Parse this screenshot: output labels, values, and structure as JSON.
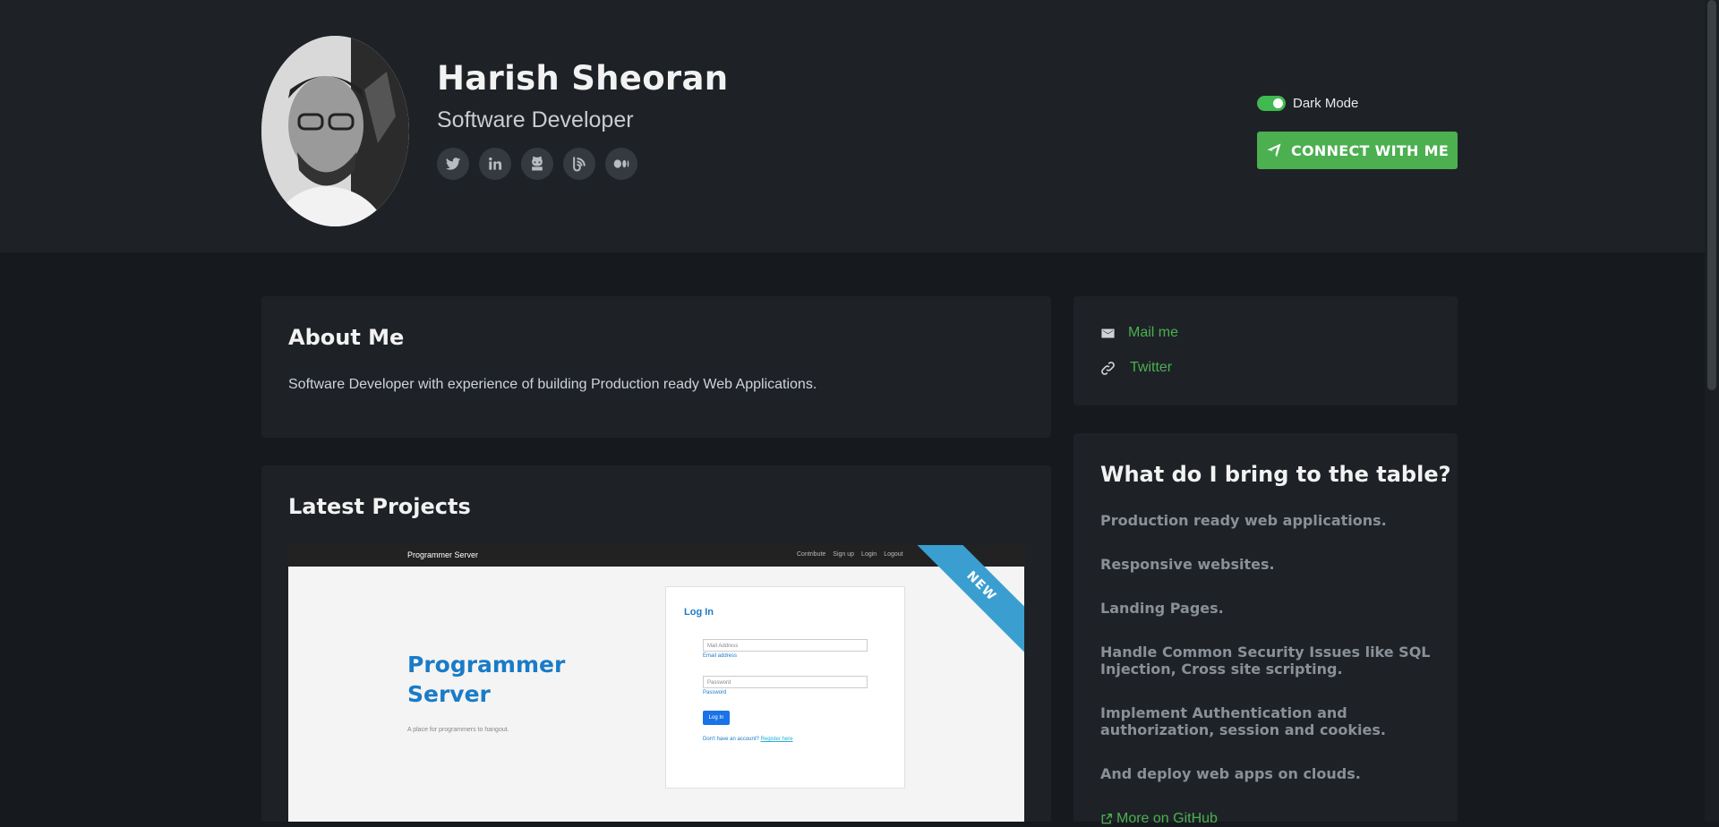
{
  "profile": {
    "name": "Harish Sheoran",
    "role": "Software Developer"
  },
  "socials": [
    {
      "name": "twitter-icon"
    },
    {
      "name": "linkedin-icon"
    },
    {
      "name": "github-icon"
    },
    {
      "name": "blog-icon"
    },
    {
      "name": "medium-icon"
    }
  ],
  "header": {
    "dark_mode_label": "Dark Mode",
    "dark_mode_on": true,
    "connect_label": "CONNECT WITH ME"
  },
  "about": {
    "title": "About Me",
    "text": "Software Developer with experience of building Production ready Web Applications."
  },
  "projects": {
    "title": "Latest Projects",
    "ribbon": "NEW",
    "preview": {
      "brand": "Programmer Server",
      "nav": [
        "Contribute",
        "Sign up",
        "Login",
        "Logout"
      ],
      "title": "Programmer Server",
      "subtitle": "A place for programmers to hangout.",
      "form_title": "Log In",
      "mail_placeholder": "Mail Address",
      "mail_help": "Email address",
      "password_placeholder": "Password",
      "password_help": "Password",
      "button": "Log In",
      "register_text": "Don't have an account?",
      "register_link": "Register here"
    }
  },
  "contact": {
    "mail_label": "Mail me",
    "twitter_label": "Twitter"
  },
  "offer": {
    "title": "What do I bring to the table?",
    "items": [
      "Production ready web applications.",
      "Responsive websites.",
      "Landing Pages.",
      "Handle Common Security Issues like SQL Injection, Cross site scripting.",
      "Implement Authentication and authorization, session and cookies.",
      "And deploy web apps on clouds."
    ],
    "more_label": "More on GitHub"
  },
  "colors": {
    "accent": "#4caf50",
    "header_bg": "#1e2227",
    "page_bg": "#161a1e"
  }
}
